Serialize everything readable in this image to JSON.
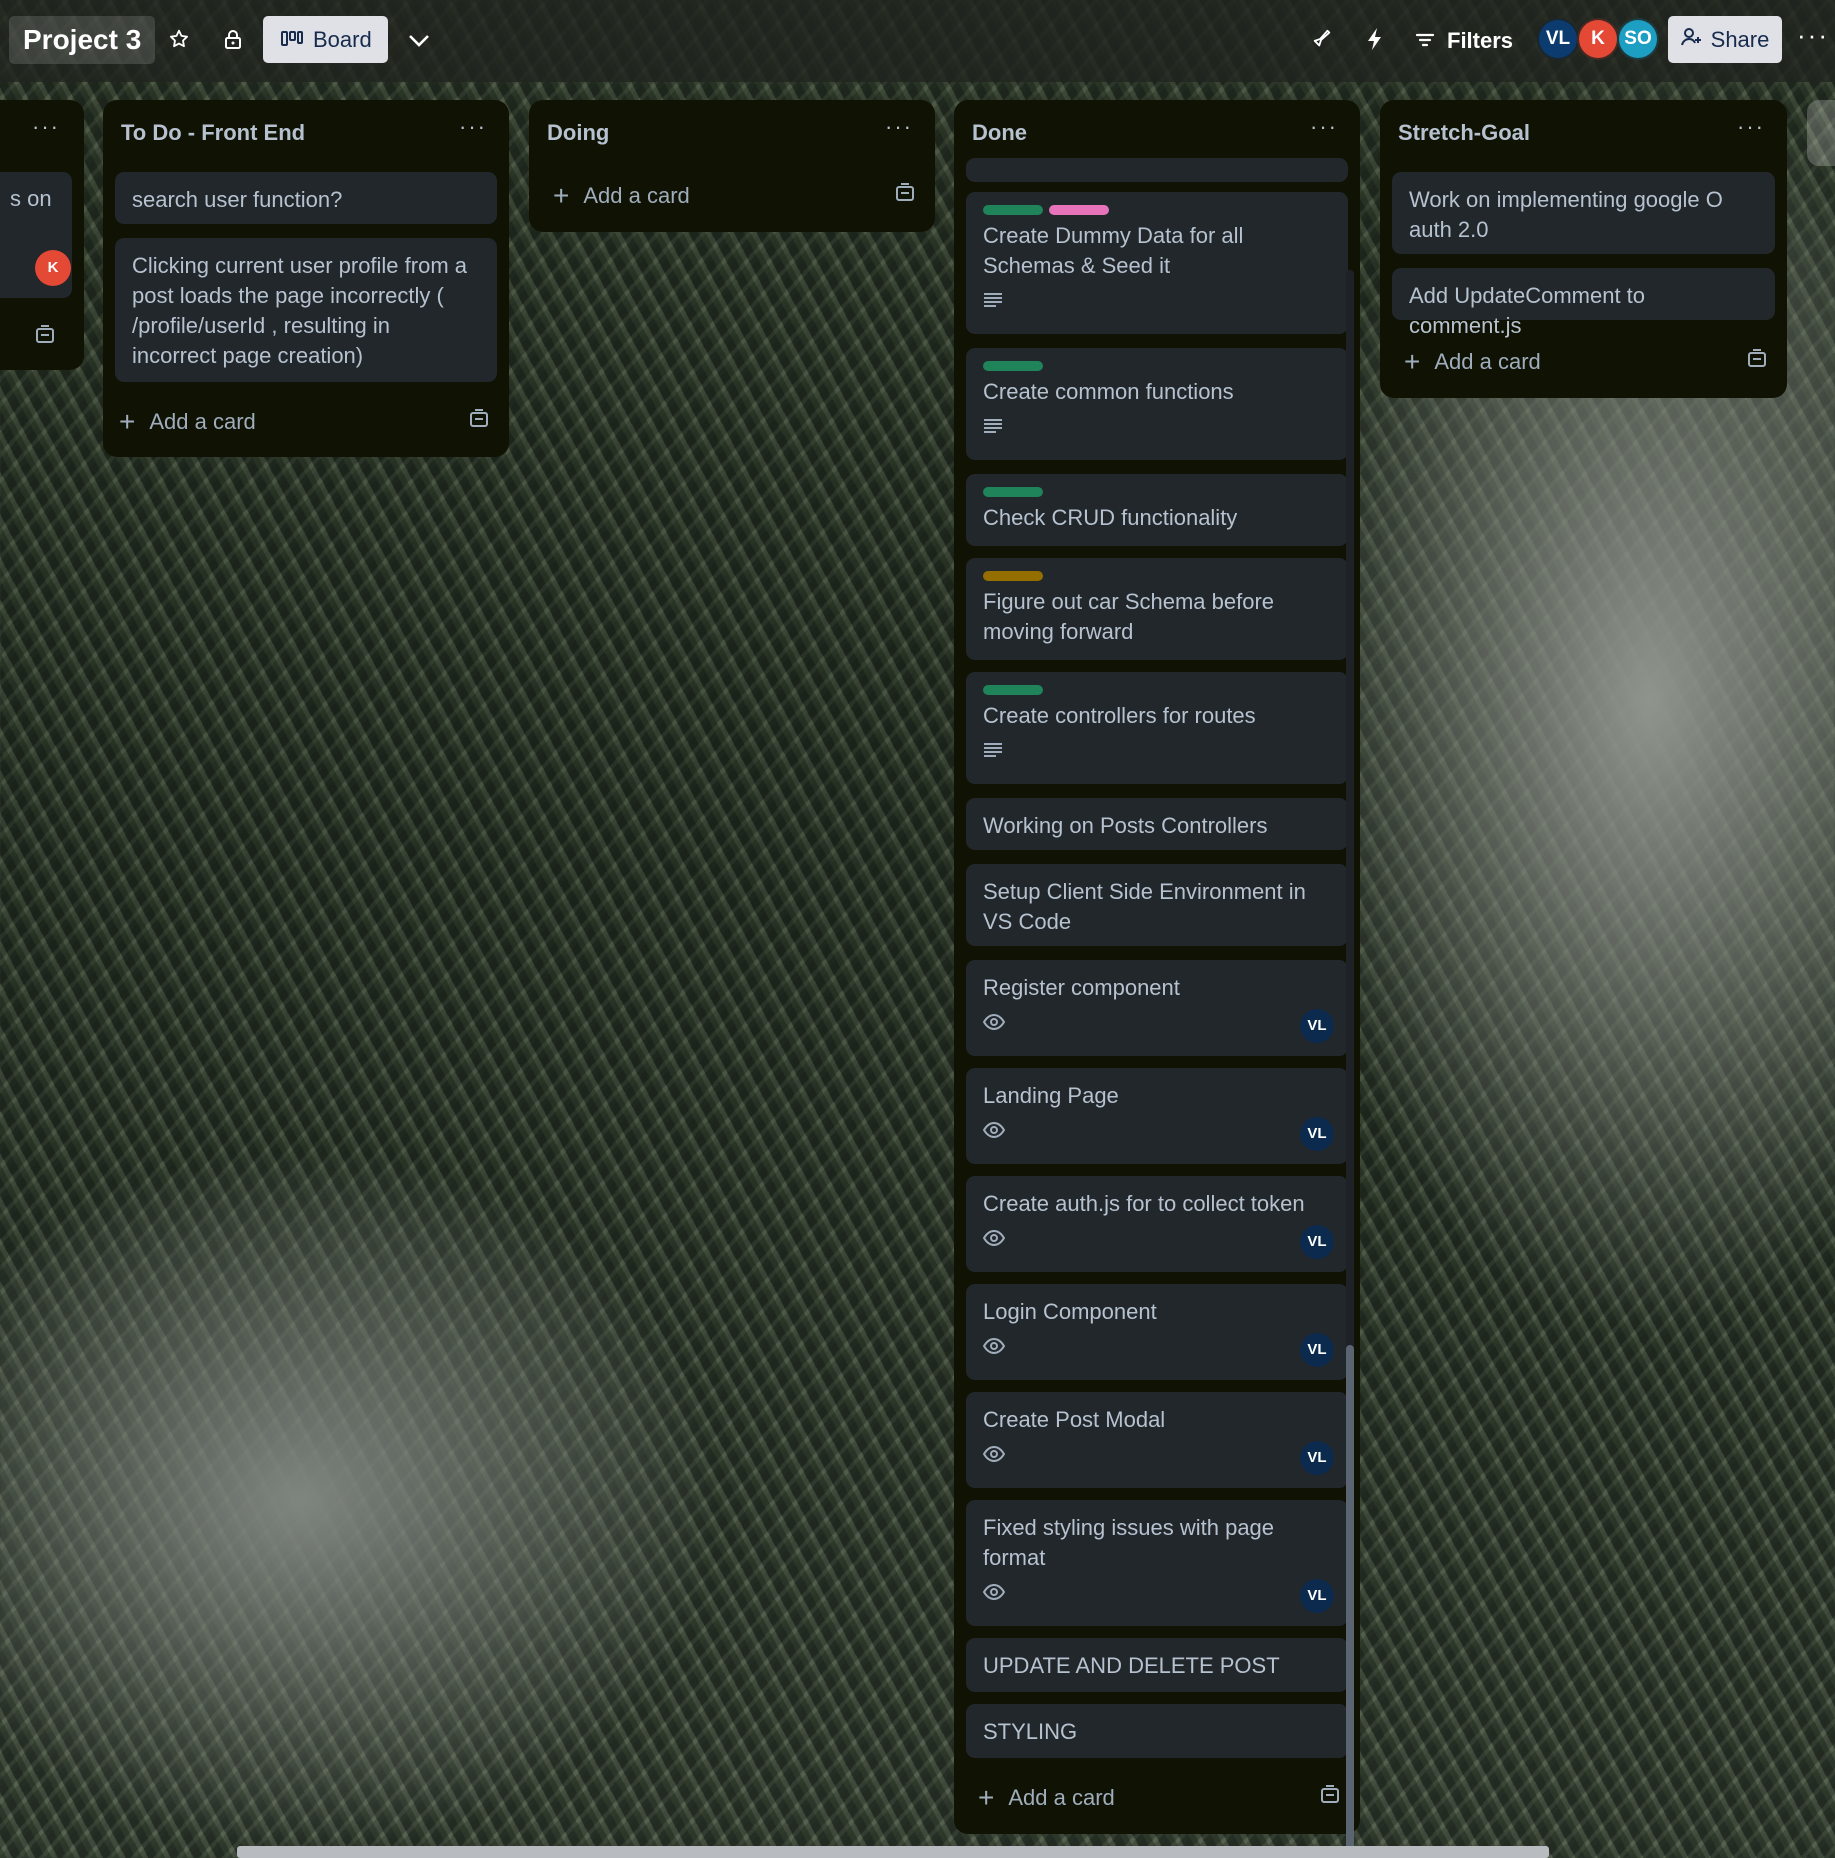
{
  "header": {
    "board_title": "Project 3",
    "view_label": "Board",
    "filters_label": "Filters",
    "share_label": "Share",
    "members": [
      {
        "initials": "VL",
        "color": "#0c3b70"
      },
      {
        "initials": "K",
        "color": "#e34935"
      },
      {
        "initials": "SO",
        "color": "#1d9fc4"
      }
    ]
  },
  "lists": {
    "partial": {
      "card_text": "s on",
      "avatar": {
        "initials": "K",
        "color": "#e34935"
      }
    },
    "todo_front_end": {
      "title": "To Do - Front End",
      "cards": [
        {
          "text": "search user function?"
        },
        {
          "text": "Clicking current user profile from a post loads the page incorrectly ( /profile/userId , resulting in incorrect page creation)"
        }
      ],
      "add_label": "Add a card"
    },
    "doing": {
      "title": "Doing",
      "add_label": "Add a card"
    },
    "done": {
      "title": "Done",
      "cards": [
        {
          "text": "Create Dummy Data for all Schemas & Seed it",
          "labels": [
            "#1f845a",
            "#e774bb"
          ]
        },
        {
          "text": "Create common functions",
          "labels": [
            "#1f845a"
          ]
        },
        {
          "text": "Check CRUD functionality",
          "labels": [
            "#1f845a"
          ]
        },
        {
          "text": "Figure out car Schema before moving forward",
          "labels": [
            "#946f00"
          ]
        },
        {
          "text": "Create controllers for routes",
          "labels": [
            "#1f845a"
          ]
        },
        {
          "text": "Working on Posts Controllers"
        },
        {
          "text": "Setup Client Side Environment in VS Code"
        },
        {
          "text": "Register component",
          "member": "VL"
        },
        {
          "text": "Landing Page",
          "member": "VL"
        },
        {
          "text": "Create auth.js for to collect token",
          "member": "VL"
        },
        {
          "text": "Login Component",
          "member": "VL"
        },
        {
          "text": "Create Post Modal",
          "member": "VL"
        },
        {
          "text": "Fixed styling issues with page format",
          "member": "VL"
        },
        {
          "text": "UPDATE AND DELETE POST"
        },
        {
          "text": "STYLING"
        }
      ],
      "add_label": "Add a card"
    },
    "stretch_goal": {
      "title": "Stretch-Goal",
      "cards": [
        {
          "text": "Work on implementing google O auth 2.0"
        },
        {
          "text": "Add UpdateComment to comment.js"
        }
      ],
      "add_label": "Add a card"
    }
  },
  "icons": {
    "star": "star-icon",
    "lock": "lock-icon",
    "board": "board-icon",
    "chevron": "chevron-down-icon",
    "rocket": "rocket-icon",
    "bolt": "bolt-icon",
    "filter": "filter-icon",
    "share": "add-person-icon",
    "description": "description-icon",
    "watch": "eye-icon",
    "template": "template-icon"
  }
}
